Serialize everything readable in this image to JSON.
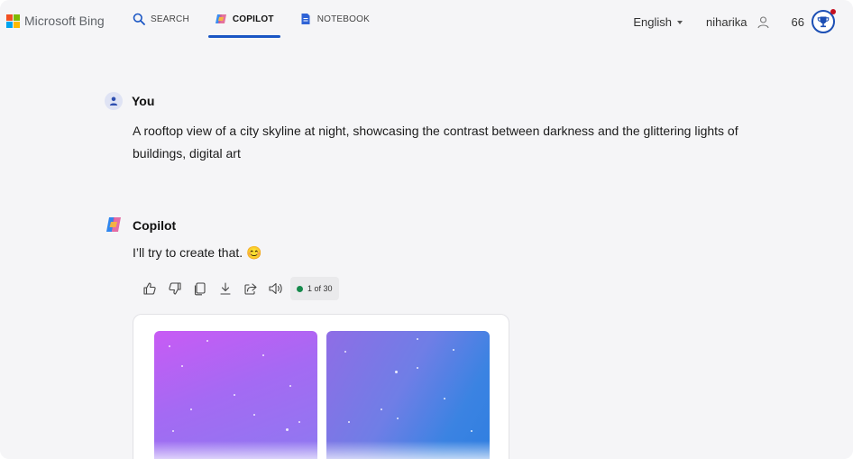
{
  "header": {
    "brand": "Microsoft Bing",
    "tabs": [
      {
        "label": "SEARCH",
        "icon": "search-icon",
        "active": false
      },
      {
        "label": "COPILOT",
        "icon": "copilot-icon",
        "active": true
      },
      {
        "label": "NOTEBOOK",
        "icon": "notebook-icon",
        "active": false
      }
    ],
    "language": "English",
    "user_name": "niharika",
    "points": "66"
  },
  "conversation": {
    "user_label": "You",
    "prompt": "A rooftop view of a city skyline at night, showcasing the contrast between darkness and the glittering lights of buildings, digital art",
    "assistant_label": "Copilot",
    "reply": "I’ll try to create that. 😊",
    "toolbar_icons": [
      "thumbs-up-icon",
      "thumbs-down-icon",
      "copy-icon",
      "download-icon",
      "share-icon",
      "read-aloud-icon"
    ],
    "response_counter": "1 of 30"
  },
  "colors": {
    "accent": "#1a56c4",
    "page_background": "#f5f5f7",
    "counter_dot": "#168a4c",
    "notification_dot": "#c50f1f"
  }
}
